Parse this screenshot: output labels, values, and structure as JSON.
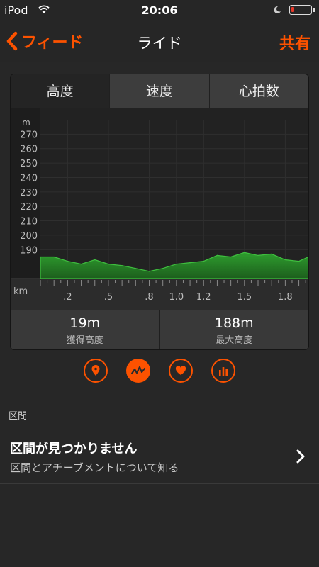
{
  "status_bar": {
    "carrier": "iPod",
    "time": "20:06",
    "battery_level": 0.15,
    "battery_color": "#e8392a"
  },
  "nav": {
    "back_label": "フィード",
    "title": "ライド",
    "share_label": "共有"
  },
  "tabs": [
    {
      "label": "高度",
      "active": true
    },
    {
      "label": "速度",
      "active": false
    },
    {
      "label": "心拍数",
      "active": false
    }
  ],
  "chart_data": {
    "type": "area",
    "ylabel": "m",
    "xlabel": "km",
    "ylim": [
      170,
      280
    ],
    "xlim": [
      0,
      1.97
    ],
    "y_ticks": [
      "190",
      "200",
      "210",
      "220",
      "230",
      "240",
      "250",
      "260",
      "270"
    ],
    "x_ticks": [
      ".2",
      ".5",
      ".8",
      "1.0",
      "1.2",
      "1.5",
      "1.8"
    ],
    "x_tick_values": [
      0.2,
      0.5,
      0.8,
      1.0,
      1.2,
      1.5,
      1.8
    ],
    "grid": true,
    "fill_color": "#2e9e2e",
    "series": [
      {
        "x": [
          0.0,
          0.1,
          0.2,
          0.3,
          0.4,
          0.5,
          0.6,
          0.7,
          0.8,
          0.9,
          1.0,
          1.1,
          1.2,
          1.3,
          1.4,
          1.5,
          1.6,
          1.7,
          1.8,
          1.9,
          1.97
        ],
        "values": [
          185,
          185,
          182,
          180,
          183,
          180,
          179,
          177,
          175,
          177,
          180,
          181,
          182,
          186,
          185,
          188,
          186,
          187,
          183,
          182,
          185
        ]
      }
    ]
  },
  "stats": [
    {
      "value": "19m",
      "label": "獲得高度"
    },
    {
      "value": "188m",
      "label": "最大高度"
    }
  ],
  "icon_buttons": [
    "pin-icon",
    "activity-icon",
    "heart-icon",
    "bar-chart-icon"
  ],
  "accent_color": "#fc5200",
  "segments": {
    "header": "区間",
    "title": "区間が見つかりません",
    "subtitle": "区間とアチーブメントについて知る"
  }
}
